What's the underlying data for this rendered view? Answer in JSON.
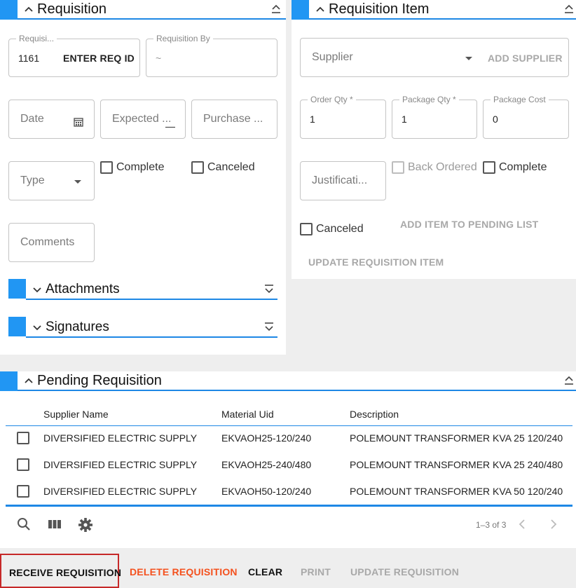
{
  "requisition": {
    "title": "Requisition",
    "req_id_legend": "Requisi...",
    "req_id_value": "1161",
    "enter_req_id": "ENTER REQ ID",
    "req_by_legend": "Requisition By",
    "req_by_value": "~",
    "date_ph": "Date",
    "expected_ph": "Expected ...",
    "purchase_ph": "Purchase ...",
    "type_ph": "Type",
    "complete_label": "Complete",
    "canceled_label": "Canceled",
    "comments_ph": "Comments",
    "attachments_title": "Attachments",
    "signatures_title": "Signatures"
  },
  "item": {
    "title": "Requisition Item",
    "supplier_ph": "Supplier",
    "add_supplier": "ADD SUPPLIER",
    "order_qty_legend": "Order Qty *",
    "order_qty_value": "1",
    "package_qty_legend": "Package Qty *",
    "package_qty_value": "1",
    "package_cost_legend": "Package Cost",
    "package_cost_value": "0",
    "justification_ph": "Justificati...",
    "back_ordered_label": "Back Ordered",
    "complete_label": "Complete",
    "canceled_label": "Canceled",
    "add_pending": "ADD ITEM TO PENDING LIST",
    "update_item": "UPDATE REQUISITION ITEM"
  },
  "pending": {
    "title": "Pending Requisition",
    "columns": [
      "Supplier Name",
      "Material Uid",
      "Description"
    ],
    "rows": [
      [
        "DIVERSIFIED ELECTRIC SUPPLY",
        "EKVAOH25-120/240",
        "POLEMOUNT TRANSFORMER KVA 25 120/240"
      ],
      [
        "DIVERSIFIED ELECTRIC SUPPLY",
        "EKVAOH25-240/480",
        "POLEMOUNT TRANSFORMER KVA 25 240/480"
      ],
      [
        "DIVERSIFIED ELECTRIC SUPPLY",
        "EKVAOH50-120/240",
        "POLEMOUNT TRANSFORMER KVA 50 120/240"
      ]
    ],
    "pagination": "1–3 of 3"
  },
  "actions": {
    "receive": "RECEIVE REQUISITION",
    "delete": "DELETE REQUISITION",
    "clear": "CLEAR",
    "print": "PRINT",
    "update": "UPDATE REQUISITION"
  },
  "colors": {
    "accent": "#2196f3",
    "danger": "#f4511e",
    "focus_outline": "#c62828"
  }
}
